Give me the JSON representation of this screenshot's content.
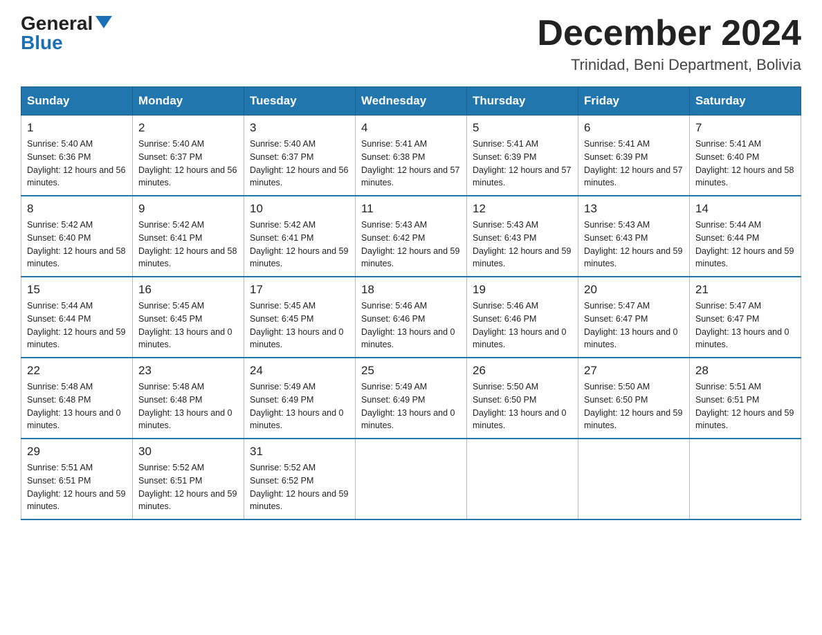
{
  "header": {
    "logo_general": "General",
    "logo_blue": "Blue",
    "month_title": "December 2024",
    "location": "Trinidad, Beni Department, Bolivia"
  },
  "weekdays": [
    "Sunday",
    "Monday",
    "Tuesday",
    "Wednesday",
    "Thursday",
    "Friday",
    "Saturday"
  ],
  "weeks": [
    [
      {
        "day": "1",
        "sunrise": "5:40 AM",
        "sunset": "6:36 PM",
        "daylight": "12 hours and 56 minutes."
      },
      {
        "day": "2",
        "sunrise": "5:40 AM",
        "sunset": "6:37 PM",
        "daylight": "12 hours and 56 minutes."
      },
      {
        "day": "3",
        "sunrise": "5:40 AM",
        "sunset": "6:37 PM",
        "daylight": "12 hours and 56 minutes."
      },
      {
        "day": "4",
        "sunrise": "5:41 AM",
        "sunset": "6:38 PM",
        "daylight": "12 hours and 57 minutes."
      },
      {
        "day": "5",
        "sunrise": "5:41 AM",
        "sunset": "6:39 PM",
        "daylight": "12 hours and 57 minutes."
      },
      {
        "day": "6",
        "sunrise": "5:41 AM",
        "sunset": "6:39 PM",
        "daylight": "12 hours and 57 minutes."
      },
      {
        "day": "7",
        "sunrise": "5:41 AM",
        "sunset": "6:40 PM",
        "daylight": "12 hours and 58 minutes."
      }
    ],
    [
      {
        "day": "8",
        "sunrise": "5:42 AM",
        "sunset": "6:40 PM",
        "daylight": "12 hours and 58 minutes."
      },
      {
        "day": "9",
        "sunrise": "5:42 AM",
        "sunset": "6:41 PM",
        "daylight": "12 hours and 58 minutes."
      },
      {
        "day": "10",
        "sunrise": "5:42 AM",
        "sunset": "6:41 PM",
        "daylight": "12 hours and 59 minutes."
      },
      {
        "day": "11",
        "sunrise": "5:43 AM",
        "sunset": "6:42 PM",
        "daylight": "12 hours and 59 minutes."
      },
      {
        "day": "12",
        "sunrise": "5:43 AM",
        "sunset": "6:43 PM",
        "daylight": "12 hours and 59 minutes."
      },
      {
        "day": "13",
        "sunrise": "5:43 AM",
        "sunset": "6:43 PM",
        "daylight": "12 hours and 59 minutes."
      },
      {
        "day": "14",
        "sunrise": "5:44 AM",
        "sunset": "6:44 PM",
        "daylight": "12 hours and 59 minutes."
      }
    ],
    [
      {
        "day": "15",
        "sunrise": "5:44 AM",
        "sunset": "6:44 PM",
        "daylight": "12 hours and 59 minutes."
      },
      {
        "day": "16",
        "sunrise": "5:45 AM",
        "sunset": "6:45 PM",
        "daylight": "13 hours and 0 minutes."
      },
      {
        "day": "17",
        "sunrise": "5:45 AM",
        "sunset": "6:45 PM",
        "daylight": "13 hours and 0 minutes."
      },
      {
        "day": "18",
        "sunrise": "5:46 AM",
        "sunset": "6:46 PM",
        "daylight": "13 hours and 0 minutes."
      },
      {
        "day": "19",
        "sunrise": "5:46 AM",
        "sunset": "6:46 PM",
        "daylight": "13 hours and 0 minutes."
      },
      {
        "day": "20",
        "sunrise": "5:47 AM",
        "sunset": "6:47 PM",
        "daylight": "13 hours and 0 minutes."
      },
      {
        "day": "21",
        "sunrise": "5:47 AM",
        "sunset": "6:47 PM",
        "daylight": "13 hours and 0 minutes."
      }
    ],
    [
      {
        "day": "22",
        "sunrise": "5:48 AM",
        "sunset": "6:48 PM",
        "daylight": "13 hours and 0 minutes."
      },
      {
        "day": "23",
        "sunrise": "5:48 AM",
        "sunset": "6:48 PM",
        "daylight": "13 hours and 0 minutes."
      },
      {
        "day": "24",
        "sunrise": "5:49 AM",
        "sunset": "6:49 PM",
        "daylight": "13 hours and 0 minutes."
      },
      {
        "day": "25",
        "sunrise": "5:49 AM",
        "sunset": "6:49 PM",
        "daylight": "13 hours and 0 minutes."
      },
      {
        "day": "26",
        "sunrise": "5:50 AM",
        "sunset": "6:50 PM",
        "daylight": "13 hours and 0 minutes."
      },
      {
        "day": "27",
        "sunrise": "5:50 AM",
        "sunset": "6:50 PM",
        "daylight": "12 hours and 59 minutes."
      },
      {
        "day": "28",
        "sunrise": "5:51 AM",
        "sunset": "6:51 PM",
        "daylight": "12 hours and 59 minutes."
      }
    ],
    [
      {
        "day": "29",
        "sunrise": "5:51 AM",
        "sunset": "6:51 PM",
        "daylight": "12 hours and 59 minutes."
      },
      {
        "day": "30",
        "sunrise": "5:52 AM",
        "sunset": "6:51 PM",
        "daylight": "12 hours and 59 minutes."
      },
      {
        "day": "31",
        "sunrise": "5:52 AM",
        "sunset": "6:52 PM",
        "daylight": "12 hours and 59 minutes."
      },
      null,
      null,
      null,
      null
    ]
  ]
}
